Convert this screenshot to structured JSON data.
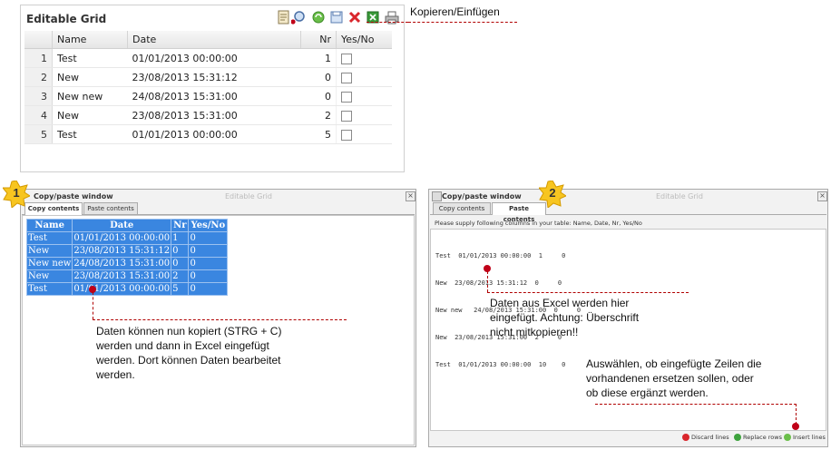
{
  "grid": {
    "title": "Editable Grid",
    "columns": [
      "Name",
      "Date",
      "Nr",
      "Yes/No"
    ],
    "rows": [
      {
        "n": "1",
        "name": "Test",
        "date": "01/01/2013 00:00:00",
        "nr": "1"
      },
      {
        "n": "2",
        "name": "New",
        "date": "23/08/2013 15:31:12",
        "nr": "0"
      },
      {
        "n": "3",
        "name": "New new",
        "date": "24/08/2013 15:31:00",
        "nr": "0"
      },
      {
        "n": "4",
        "name": "New",
        "date": "23/08/2013 15:31:00",
        "nr": "2"
      },
      {
        "n": "5",
        "name": "Test",
        "date": "01/01/2013 00:00:00",
        "nr": "5"
      }
    ],
    "toolbar_icons": [
      "export-icon",
      "search-icon",
      "refresh-icon",
      "save-icon",
      "delete-icon",
      "excel-icon",
      "print-icon"
    ]
  },
  "callouts": {
    "top": "Kopieren/Einfügen",
    "copy_lines": [
      "Daten können nun kopiert (STRG + C)",
      "werden und dann in Excel eingefügt",
      "werden. Dort können Daten bearbeitet",
      "werden."
    ],
    "paste_lines": [
      "Daten aus Excel werden hier",
      "eingefügt. Achtung: Überschrift",
      "nicht mitkopieren!!"
    ],
    "insert_lines": [
      "Auswählen, ob eingefügte Zeilen die",
      "vorhandenen ersetzen sollen, oder",
      "ob diese ergänzt werden."
    ]
  },
  "badges": {
    "one": "1",
    "two": "2"
  },
  "copy_window": {
    "title": "Copy/paste window",
    "ghost": "Editable Grid",
    "tabs": [
      "Copy contents",
      "Paste contents"
    ],
    "table_headers": [
      "Name",
      "Date",
      "Nr",
      "Yes/No"
    ],
    "table_rows": [
      [
        "Test",
        "01/01/2013 00:00:00",
        "1",
        "0"
      ],
      [
        "New",
        "23/08/2013 15:31:12",
        "0",
        "0"
      ],
      [
        "New new",
        "24/08/2013 15:31:00",
        "0",
        "0"
      ],
      [
        "New",
        "23/08/2013 15:31:00",
        "2",
        "0"
      ],
      [
        "Test",
        "01/01/2013 00:00:00",
        "5",
        "0"
      ]
    ]
  },
  "paste_window": {
    "title": "Copy/paste window",
    "ghost": "Editable Grid",
    "tabs": [
      "Copy contents",
      "Paste contents"
    ],
    "hint": "Please supply following columns in your table: Name, Date, Nr, Yes/No",
    "content_lines": [
      "Test  01/01/2013 00:00:00  1     0",
      "New  23/08/2013 15:31:12  0     0",
      "New new   24/08/2013 15:31:00  0     0",
      "New  23/08/2013 15:31:00  2     0",
      "Test  01/01/2013 00:00:00  10    0"
    ],
    "buttons": {
      "discard": "Discard lines",
      "replace": "Replace rows",
      "insert": "Insert lines"
    }
  },
  "colors": {
    "accent_red": "#c00018",
    "selection_blue": "#3a86e0",
    "badge_yellow": "#f7c520"
  }
}
